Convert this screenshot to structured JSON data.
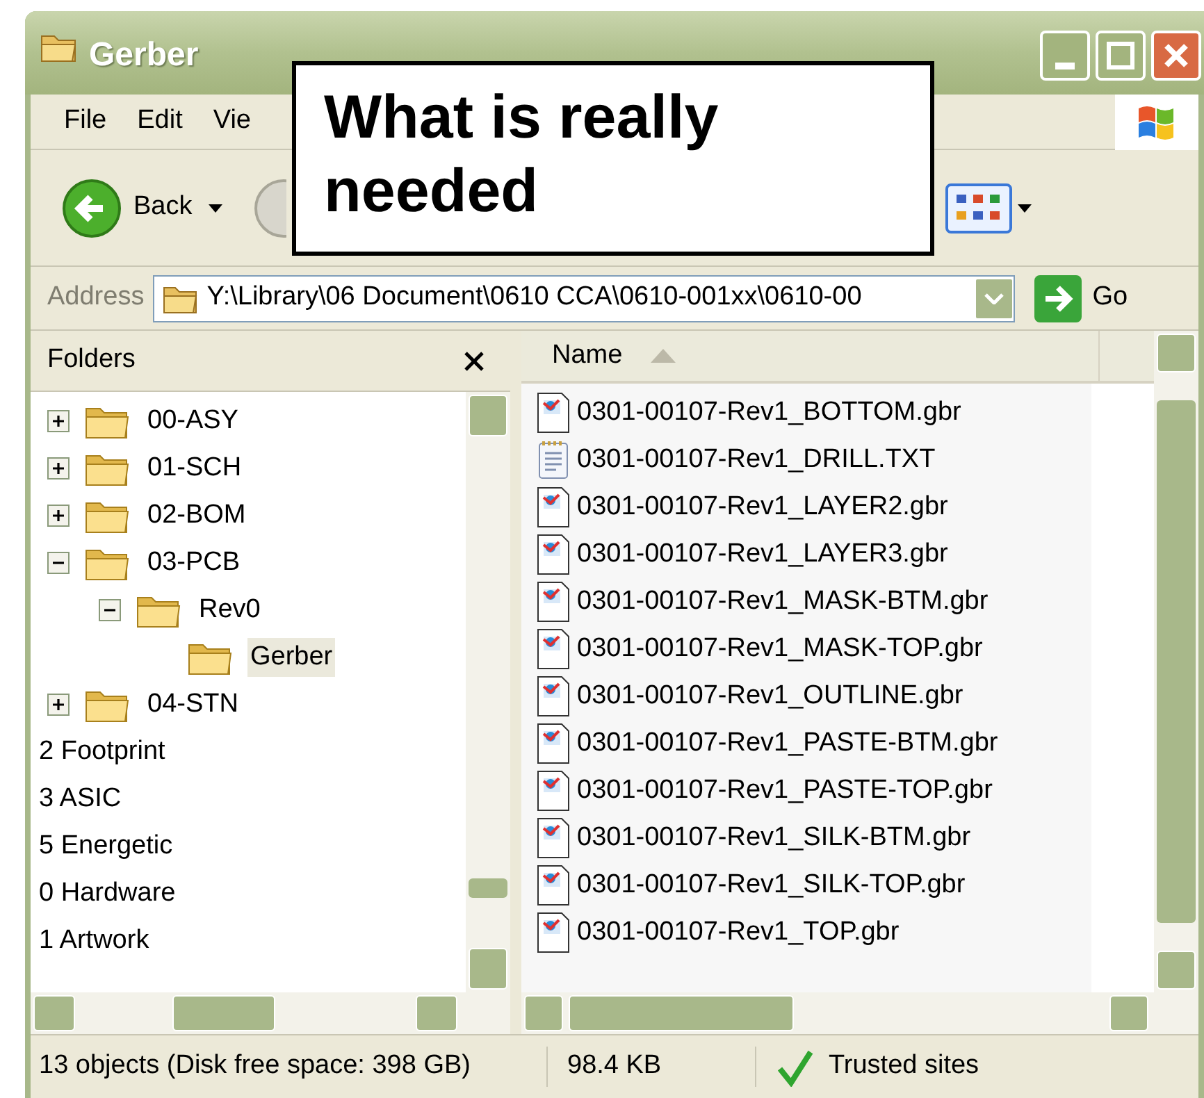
{
  "window": {
    "title": "Gerber"
  },
  "menu": [
    "File",
    "Edit",
    "Vie"
  ],
  "toolbar": {
    "back_label": "Back"
  },
  "address": {
    "label": "Address",
    "path": "Y:\\Library\\06 Document\\0610 CCA\\0610-001xx\\0610-00",
    "go_label": "Go"
  },
  "callout": {
    "text": "What is really needed"
  },
  "folders_pane": {
    "title": "Folders",
    "tree": [
      {
        "kind": "folder",
        "label": "00-ASY",
        "expanded": false,
        "selected": false
      },
      {
        "kind": "folder",
        "label": "01-SCH",
        "expanded": false,
        "selected": false
      },
      {
        "kind": "folder",
        "label": "02-BOM",
        "expanded": false,
        "selected": false
      },
      {
        "kind": "folder",
        "label": "03-PCB",
        "expanded": true,
        "selected": false,
        "children": [
          {
            "kind": "folder",
            "label": "Rev0",
            "expanded": true,
            "selected": false,
            "children": [
              {
                "kind": "leaf",
                "label": "Gerber",
                "selected": true
              }
            ]
          }
        ]
      },
      {
        "kind": "folder",
        "label": "04-STN",
        "expanded": false,
        "selected": false
      },
      {
        "kind": "label",
        "label": "2 Footprint",
        "selected": false
      },
      {
        "kind": "label",
        "label": "3 ASIC",
        "selected": false
      },
      {
        "kind": "label",
        "label": "5 Energetic",
        "selected": false
      },
      {
        "kind": "label",
        "label": "0 Hardware",
        "selected": false
      },
      {
        "kind": "label",
        "label": "1 Artwork",
        "selected": false
      }
    ]
  },
  "files": {
    "columns": [
      {
        "label": "Name",
        "sorted": true
      }
    ],
    "items": [
      {
        "kind": "gerber",
        "name": "0301-00107-Rev1_BOTTOM.gbr"
      },
      {
        "kind": "text",
        "name": "0301-00107-Rev1_DRILL.TXT"
      },
      {
        "kind": "gerber",
        "name": "0301-00107-Rev1_LAYER2.gbr"
      },
      {
        "kind": "gerber",
        "name": "0301-00107-Rev1_LAYER3.gbr"
      },
      {
        "kind": "gerber",
        "name": "0301-00107-Rev1_MASK-BTM.gbr"
      },
      {
        "kind": "gerber",
        "name": "0301-00107-Rev1_MASK-TOP.gbr"
      },
      {
        "kind": "gerber",
        "name": "0301-00107-Rev1_OUTLINE.gbr"
      },
      {
        "kind": "gerber",
        "name": "0301-00107-Rev1_PASTE-BTM.gbr"
      },
      {
        "kind": "gerber",
        "name": "0301-00107-Rev1_PASTE-TOP.gbr"
      },
      {
        "kind": "gerber",
        "name": "0301-00107-Rev1_SILK-BTM.gbr"
      },
      {
        "kind": "gerber",
        "name": "0301-00107-Rev1_SILK-TOP.gbr"
      },
      {
        "kind": "gerber",
        "name": "0301-00107-Rev1_TOP.gbr"
      }
    ]
  },
  "status_bar": {
    "objects": "13 objects (Disk free space: 398 GB)",
    "size": "98.4 KB",
    "zone": "Trusted sites"
  }
}
